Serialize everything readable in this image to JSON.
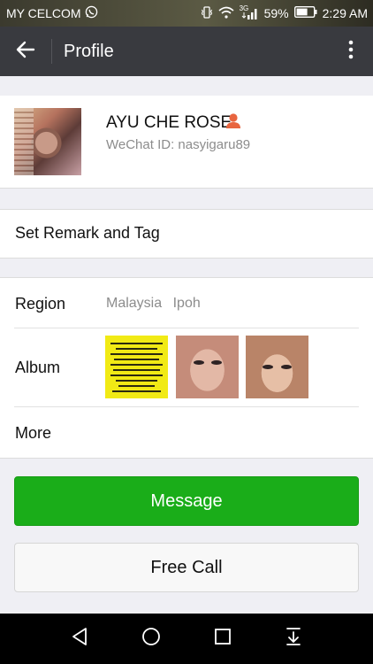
{
  "status_bar": {
    "carrier": "MY CELCOM",
    "network": "3G",
    "battery": "59%",
    "time": "2:29 AM"
  },
  "toolbar": {
    "title": "Profile"
  },
  "profile": {
    "name": "AYU CHE ROSE",
    "wechat_id": "WeChat ID: nasyigaru89"
  },
  "remark": {
    "label": "Set Remark and Tag"
  },
  "info": {
    "region_label": "Region",
    "region_country": "Malaysia",
    "region_city": "Ipoh",
    "album_label": "Album",
    "more_label": "More"
  },
  "actions": {
    "message_label": "Message",
    "call_label": "Free Call"
  },
  "colors": {
    "toolbar": "#393a3f",
    "primary_green": "#1aad19",
    "background": "#efeff4"
  },
  "icons": [
    "whatsapp-icon",
    "vibrate-icon",
    "wifi-icon",
    "signal-icon",
    "battery-icon",
    "back-arrow-icon",
    "more-vert-icon",
    "person-icon",
    "nav-back-icon",
    "nav-home-icon",
    "nav-recents-icon",
    "nav-notification-icon"
  ]
}
